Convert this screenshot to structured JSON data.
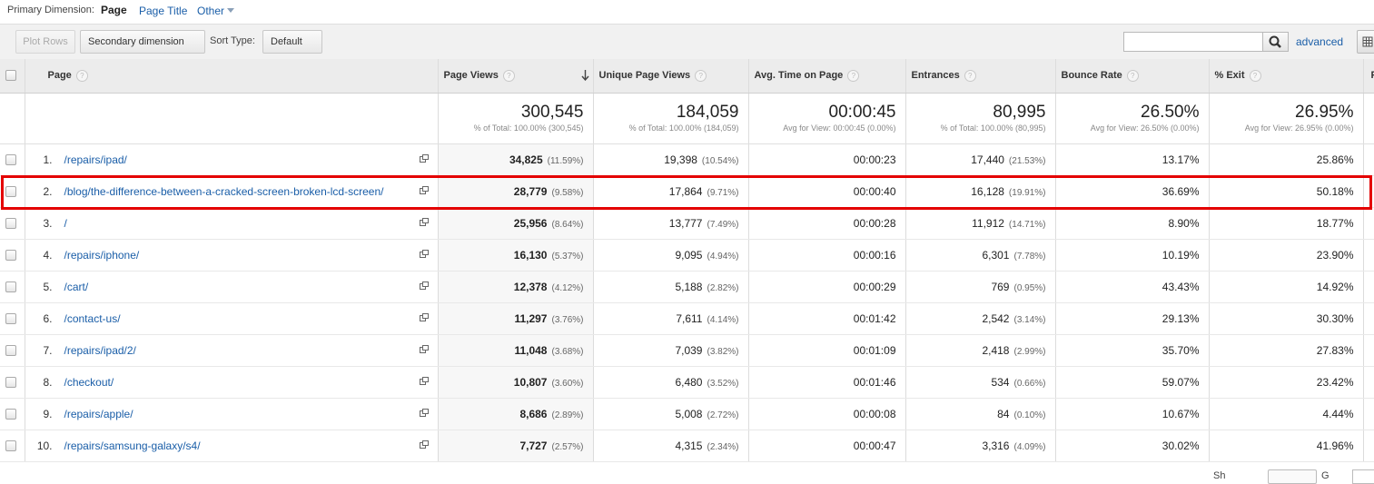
{
  "primary_dimension": {
    "label": "Primary Dimension:",
    "options": [
      "Page",
      "Page Title",
      "Other"
    ],
    "selected": "Page"
  },
  "toolbar": {
    "plot_rows": "Plot Rows",
    "secondary_dimension": "Secondary dimension",
    "sort_type_label": "Sort Type:",
    "sort_type_value": "Default",
    "search_value": "",
    "advanced": "advanced"
  },
  "table": {
    "headers": {
      "page": "Page",
      "page_views": "Page Views",
      "unique_page_views": "Unique Page Views",
      "avg_time": "Avg. Time on Page",
      "entrances": "Entrances",
      "bounce_rate": "Bounce Rate",
      "exit": "% Exit",
      "extra": "P"
    },
    "totals": {
      "page_views": "300,545",
      "page_views_sub": "% of Total: 100.00% (300,545)",
      "unique_page_views": "184,059",
      "unique_page_views_sub": "% of Total: 100.00% (184,059)",
      "avg_time": "00:00:45",
      "avg_time_sub": "Avg for View: 00:00:45 (0.00%)",
      "entrances": "80,995",
      "entrances_sub": "% of Total: 100.00% (80,995)",
      "bounce_rate": "26.50%",
      "bounce_rate_sub": "Avg for View: 26.50% (0.00%)",
      "exit": "26.95%",
      "exit_sub": "Avg for View: 26.95% (0.00%)"
    },
    "rows": [
      {
        "idx": "1.",
        "page": "/repairs/ipad/",
        "pv": "34,825",
        "pv_pct": "(11.59%)",
        "upv": "19,398",
        "upv_pct": "(10.54%)",
        "time": "00:00:23",
        "ent": "17,440",
        "ent_pct": "(21.53%)",
        "bounce": "13.17%",
        "exit": "25.86%"
      },
      {
        "idx": "2.",
        "page": "/blog/the-difference-between-a-cracked-screen-broken-lcd-screen/",
        "pv": "28,779",
        "pv_pct": "(9.58%)",
        "upv": "17,864",
        "upv_pct": "(9.71%)",
        "time": "00:00:40",
        "ent": "16,128",
        "ent_pct": "(19.91%)",
        "bounce": "36.69%",
        "exit": "50.18%"
      },
      {
        "idx": "3.",
        "page": "/",
        "pv": "25,956",
        "pv_pct": "(8.64%)",
        "upv": "13,777",
        "upv_pct": "(7.49%)",
        "time": "00:00:28",
        "ent": "11,912",
        "ent_pct": "(14.71%)",
        "bounce": "8.90%",
        "exit": "18.77%"
      },
      {
        "idx": "4.",
        "page": "/repairs/iphone/",
        "pv": "16,130",
        "pv_pct": "(5.37%)",
        "upv": "9,095",
        "upv_pct": "(4.94%)",
        "time": "00:00:16",
        "ent": "6,301",
        "ent_pct": "(7.78%)",
        "bounce": "10.19%",
        "exit": "23.90%"
      },
      {
        "idx": "5.",
        "page": "/cart/",
        "pv": "12,378",
        "pv_pct": "(4.12%)",
        "upv": "5,188",
        "upv_pct": "(2.82%)",
        "time": "00:00:29",
        "ent": "769",
        "ent_pct": "(0.95%)",
        "bounce": "43.43%",
        "exit": "14.92%"
      },
      {
        "idx": "6.",
        "page": "/contact-us/",
        "pv": "11,297",
        "pv_pct": "(3.76%)",
        "upv": "7,611",
        "upv_pct": "(4.14%)",
        "time": "00:01:42",
        "ent": "2,542",
        "ent_pct": "(3.14%)",
        "bounce": "29.13%",
        "exit": "30.30%"
      },
      {
        "idx": "7.",
        "page": "/repairs/ipad/2/",
        "pv": "11,048",
        "pv_pct": "(3.68%)",
        "upv": "7,039",
        "upv_pct": "(3.82%)",
        "time": "00:01:09",
        "ent": "2,418",
        "ent_pct": "(2.99%)",
        "bounce": "35.70%",
        "exit": "27.83%"
      },
      {
        "idx": "8.",
        "page": "/checkout/",
        "pv": "10,807",
        "pv_pct": "(3.60%)",
        "upv": "6,480",
        "upv_pct": "(3.52%)",
        "time": "00:01:46",
        "ent": "534",
        "ent_pct": "(0.66%)",
        "bounce": "59.07%",
        "exit": "23.42%"
      },
      {
        "idx": "9.",
        "page": "/repairs/apple/",
        "pv": "8,686",
        "pv_pct": "(2.89%)",
        "upv": "5,008",
        "upv_pct": "(2.72%)",
        "time": "00:00:08",
        "ent": "84",
        "ent_pct": "(0.10%)",
        "bounce": "10.67%",
        "exit": "4.44%"
      },
      {
        "idx": "10.",
        "page": "/repairs/samsung-galaxy/s4/",
        "pv": "7,727",
        "pv_pct": "(2.57%)",
        "upv": "4,315",
        "upv_pct": "(2.34%)",
        "time": "00:00:47",
        "ent": "3,316",
        "ent_pct": "(4.09%)",
        "bounce": "30.02%",
        "exit": "41.96%"
      }
    ]
  },
  "footer": {
    "show_fragment": "Sh",
    "goto_fragment": "G"
  },
  "colors": {
    "link": "#1a5ea8",
    "highlight": "#e40000",
    "header_bg": "#ececec"
  },
  "icons": {
    "sort": "arrow-down-icon",
    "search": "magnifier-icon",
    "external": "open-in-new-window-icon",
    "grid": "grid-view-icon"
  }
}
